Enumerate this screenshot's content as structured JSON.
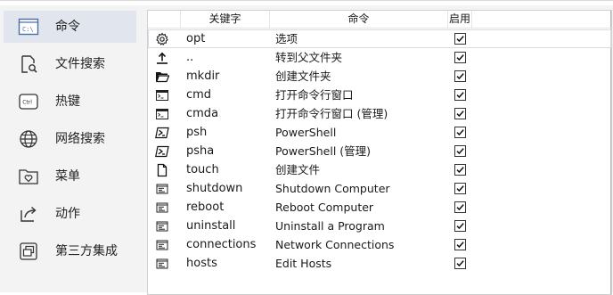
{
  "sidebar": {
    "items": [
      {
        "label": "命令",
        "icon": "command-window-icon",
        "active": true
      },
      {
        "label": "文件搜索",
        "icon": "file-search-icon",
        "active": false
      },
      {
        "label": "热键",
        "icon": "ctrl-key-icon",
        "active": false
      },
      {
        "label": "网络搜索",
        "icon": "globe-icon",
        "active": false
      },
      {
        "label": "菜单",
        "icon": "folder-heart-icon",
        "active": false
      },
      {
        "label": "动作",
        "icon": "share-arrow-icon",
        "active": false
      },
      {
        "label": "第三方集成",
        "icon": "window-stack-icon",
        "active": false
      }
    ],
    "icon_text": {
      "command": "C:\\",
      "ctrl": "Ctrl"
    }
  },
  "table": {
    "headers": {
      "keyword": "关键字",
      "command": "命令",
      "enabled": "启用"
    },
    "rows": [
      {
        "icon": "gear-icon",
        "keyword": "opt",
        "command": "选项",
        "enabled": true
      },
      {
        "icon": "upload-arrow-icon",
        "keyword": "..",
        "command": "转到父文件夹",
        "enabled": true
      },
      {
        "icon": "folder-open-icon",
        "keyword": "mkdir",
        "command": "创建文件夹",
        "enabled": true
      },
      {
        "icon": "terminal-icon",
        "keyword": "cmd",
        "command": "打开命令行窗口",
        "enabled": true
      },
      {
        "icon": "terminal-icon",
        "keyword": "cmda",
        "command": "打开命令行窗口 (管理)",
        "enabled": true
      },
      {
        "icon": "powershell-icon",
        "keyword": "psh",
        "command": "PowerShell",
        "enabled": true
      },
      {
        "icon": "powershell-icon",
        "keyword": "psha",
        "command": "PowerShell (管理)",
        "enabled": true
      },
      {
        "icon": "file-icon",
        "keyword": "touch",
        "command": "创建文件",
        "enabled": true
      },
      {
        "icon": "system-command-icon",
        "keyword": "shutdown",
        "command": "Shutdown Computer",
        "enabled": true
      },
      {
        "icon": "system-command-icon",
        "keyword": "reboot",
        "command": "Reboot Computer",
        "enabled": true
      },
      {
        "icon": "system-command-icon",
        "keyword": "uninstall",
        "command": "Uninstall a Program",
        "enabled": true
      },
      {
        "icon": "system-command-icon",
        "keyword": "connections",
        "command": "Network Connections",
        "enabled": true
      },
      {
        "icon": "system-command-icon",
        "keyword": "hosts",
        "command": "Edit Hosts",
        "enabled": true
      }
    ]
  },
  "colors": {
    "sidebar_bg": "#f3f3f3",
    "active_bg": "#e1e6ee",
    "panel_bg": "#ffffff"
  }
}
